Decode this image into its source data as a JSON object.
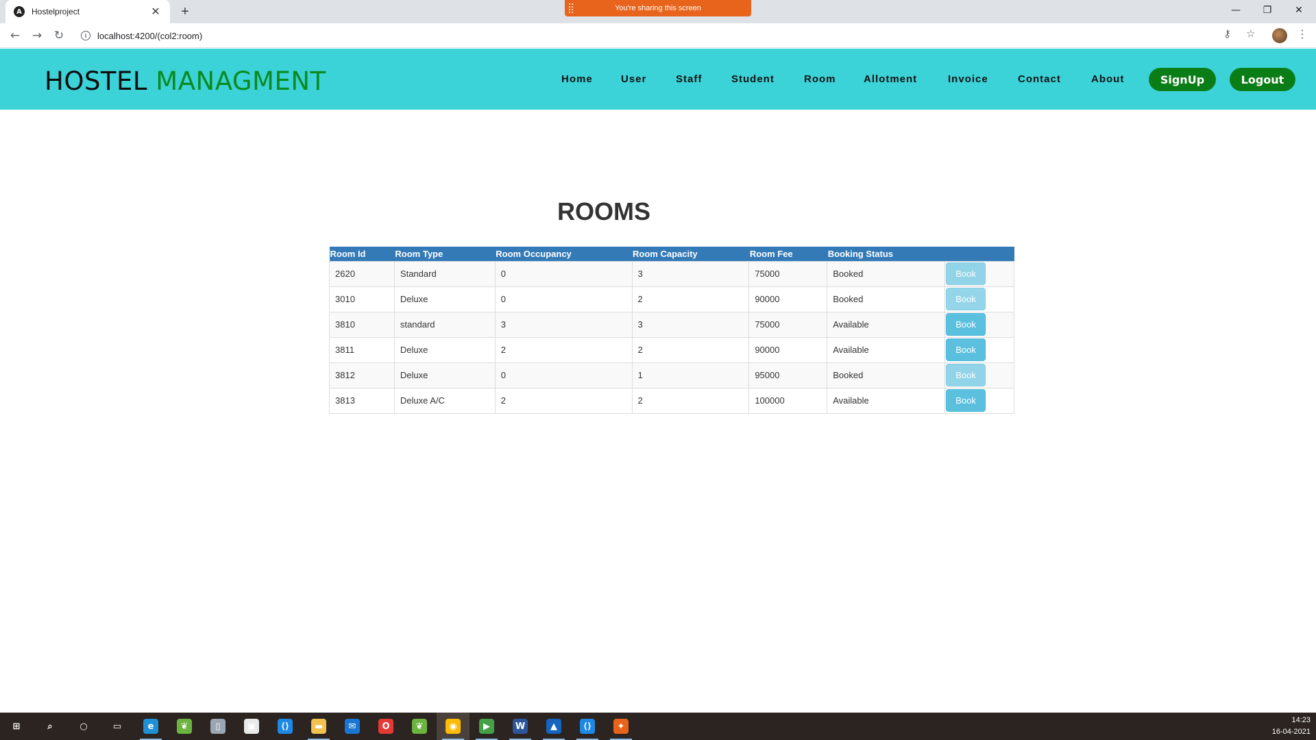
{
  "browser": {
    "tab_title": "Hostelproject",
    "favicon_letter": "A",
    "close_glyph": "✕",
    "new_tab_glyph": "+",
    "sharing_banner": "You're sharing this screen",
    "url": "localhost:4200/(col2:room)",
    "info_glyph": "i",
    "win_min": "—",
    "win_restore": "❐",
    "win_close": "✕",
    "back_glyph": "←",
    "forward_glyph": "→",
    "reload_glyph": "↻",
    "key_glyph": "⚷",
    "star_glyph": "☆",
    "kebab_glyph": "⋮"
  },
  "header": {
    "brand_part1": "HOSTEL",
    "brand_part2": "MANAGMENT",
    "nav": [
      "Home",
      "User",
      "Staff",
      "Student",
      "Room",
      "Allotment",
      "Invoice",
      "Contact",
      "About"
    ],
    "signup_label": "SignUp",
    "logout_label": "Logout",
    "bg_color": "#3bd3d8",
    "button_color": "#0b7d17"
  },
  "main": {
    "title": "ROOMS",
    "columns": [
      "Room Id",
      "Room Type",
      "Room Occupancy",
      "Room Capacity",
      "Room Fee",
      "Booking Status",
      ""
    ],
    "book_label": "Book",
    "rows": [
      {
        "id": "2620",
        "type": "Standard",
        "occupancy": "0",
        "capacity": "3",
        "fee": "75000",
        "status": "Booked",
        "book_enabled": false
      },
      {
        "id": "3010",
        "type": "Deluxe",
        "occupancy": "0",
        "capacity": "2",
        "fee": "90000",
        "status": "Booked",
        "book_enabled": false
      },
      {
        "id": "3810",
        "type": "standard",
        "occupancy": "3",
        "capacity": "3",
        "fee": "75000",
        "status": "Available",
        "book_enabled": true
      },
      {
        "id": "3811",
        "type": "Deluxe",
        "occupancy": "2",
        "capacity": "2",
        "fee": "90000",
        "status": "Available",
        "book_enabled": true
      },
      {
        "id": "3812",
        "type": "Deluxe",
        "occupancy": "0",
        "capacity": "1",
        "fee": "95000",
        "status": "Booked",
        "book_enabled": false
      },
      {
        "id": "3813",
        "type": "Deluxe A/C",
        "occupancy": "2",
        "capacity": "2",
        "fee": "100000",
        "status": "Available",
        "book_enabled": true
      }
    ],
    "header_color": "#337ab7",
    "book_color": "#5bc0de"
  },
  "taskbar": {
    "apps": [
      {
        "name": "windows-start-icon",
        "color": "#2b2420",
        "glyph": "⊞"
      },
      {
        "name": "search-icon",
        "color": "#2b2420",
        "glyph": "⌕"
      },
      {
        "name": "cortana-icon",
        "color": "#2b2420",
        "glyph": "○"
      },
      {
        "name": "task-view-icon",
        "color": "#2b2420",
        "glyph": "▭"
      },
      {
        "name": "edge-icon",
        "color": "#1f8fd6",
        "glyph": "e"
      },
      {
        "name": "spring-tool-icon",
        "color": "#6cb33f",
        "glyph": "❦"
      },
      {
        "name": "database-icon",
        "color": "#9aa6b2",
        "glyph": "▯"
      },
      {
        "name": "store-icon",
        "color": "#e9e9e9",
        "glyph": "▣"
      },
      {
        "name": "vscode-icon",
        "color": "#1e88e5",
        "glyph": "⟨⟩"
      },
      {
        "name": "file-explorer-icon",
        "color": "#f2c14e",
        "glyph": "▬"
      },
      {
        "name": "mail-icon",
        "color": "#1976d2",
        "glyph": "✉"
      },
      {
        "name": "opera-icon",
        "color": "#e53935",
        "glyph": "O"
      },
      {
        "name": "spring-tool-2-icon",
        "color": "#6cb33f",
        "glyph": "❦"
      },
      {
        "name": "chrome-icon",
        "color": "#fbbc05",
        "glyph": "◉"
      },
      {
        "name": "media-player-icon",
        "color": "#43a047",
        "glyph": "▶"
      },
      {
        "name": "word-icon",
        "color": "#2b579a",
        "glyph": "W"
      },
      {
        "name": "photos-icon",
        "color": "#1565c0",
        "glyph": "▲"
      },
      {
        "name": "vscode-2-icon",
        "color": "#1e88e5",
        "glyph": "⟨⟩"
      },
      {
        "name": "postman-icon",
        "color": "#e8641c",
        "glyph": "✦"
      }
    ],
    "time": "14:23",
    "date": "16-04-2021"
  }
}
